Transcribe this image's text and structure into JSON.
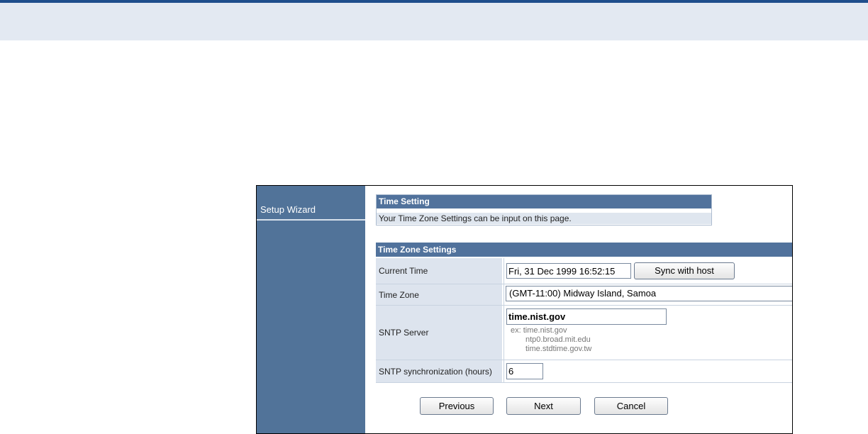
{
  "sidebar": {
    "items": [
      {
        "label": "Setup Wizard"
      }
    ]
  },
  "header": {
    "title": "Time Setting",
    "description": "Your Time Zone Settings can be input on this page."
  },
  "section": {
    "title": "Time Zone Settings",
    "rows": {
      "current_time": {
        "label": "Current Time",
        "value": "Fri, 31 Dec 1999 16:52:15",
        "button": "Sync with host"
      },
      "time_zone": {
        "label": "Time Zone",
        "value": "(GMT-11:00) Midway Island, Samoa"
      },
      "sntp_server": {
        "label": "SNTP Server",
        "value": "time.nist.gov",
        "examples": [
          "ex: time.nist.gov",
          "ntp0.broad.mit.edu",
          "time.stdtime.gov.tw"
        ]
      },
      "sntp_sync": {
        "label": "SNTP synchronization (hours)",
        "value": "6"
      }
    }
  },
  "buttons": {
    "previous": "Previous",
    "next": "Next",
    "cancel": "Cancel"
  }
}
